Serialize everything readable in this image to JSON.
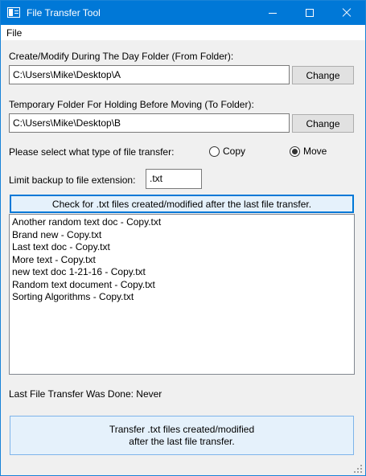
{
  "window": {
    "title": "File Transfer Tool"
  },
  "menu": {
    "file": "File"
  },
  "from_folder": {
    "label": "Create/Modify During The Day Folder (From Folder):",
    "path": "C:\\Users\\Mike\\Desktop\\A",
    "change_label": "Change"
  },
  "to_folder": {
    "label": "Temporary Folder For Holding Before Moving (To Folder):",
    "path": "C:\\Users\\Mike\\Desktop\\B",
    "change_label": "Change"
  },
  "transfer_type": {
    "label": "Please select what type of file transfer:",
    "options": [
      "Copy",
      "Move"
    ],
    "selected": "Move"
  },
  "extension": {
    "label": "Limit backup to file extension:",
    "value": ".txt"
  },
  "check_button": {
    "label": "Check for .txt files created/modified after the last file transfer."
  },
  "files": [
    "Another random text doc - Copy.txt",
    "Brand new - Copy.txt",
    "Last text doc - Copy.txt",
    "More text - Copy.txt",
    "new text doc 1-21-16 - Copy.txt",
    "Random text document - Copy.txt",
    "Sorting Algorithms - Copy.txt"
  ],
  "last_transfer": {
    "text": "Last File Transfer Was Done: Never"
  },
  "transfer_button": {
    "line1": "Transfer .txt files created/modified",
    "line2": "after the last file transfer."
  }
}
